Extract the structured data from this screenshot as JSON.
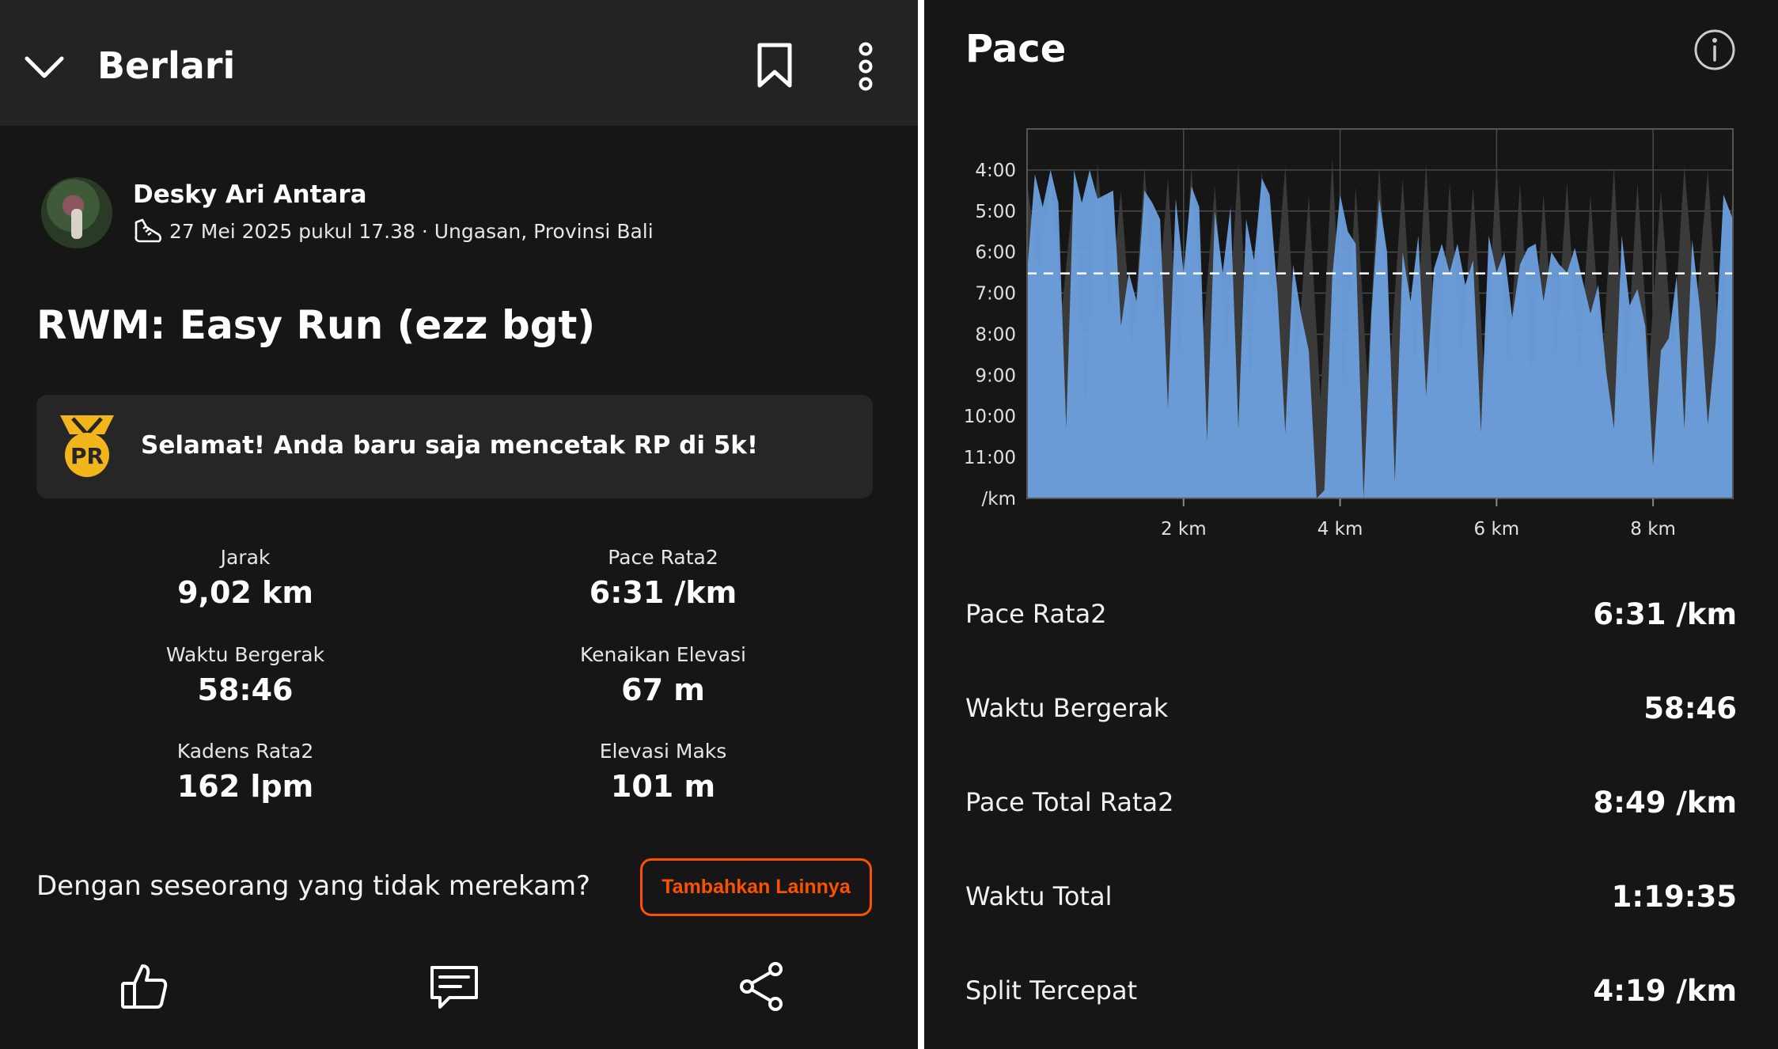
{
  "header": {
    "title": "Berlari"
  },
  "athlete": {
    "name": "Desky Ari Antara",
    "meta": "27 Mei 2025 pukul 17.38 · Ungasan, Provinsi Bali"
  },
  "activity": {
    "title": "RWM: Easy Run (ezz bgt)"
  },
  "pr_card": {
    "badge_text": "PR",
    "message": "Selamat! Anda baru saja mencetak RP di 5k!"
  },
  "stats": [
    {
      "label": "Jarak",
      "value": "9,02 km"
    },
    {
      "label": "Pace Rata2",
      "value": "6:31 /km"
    },
    {
      "label": "Waktu Bergerak",
      "value": "58:46"
    },
    {
      "label": "Kenaikan Elevasi",
      "value": "67 m"
    },
    {
      "label": "Kadens Rata2",
      "value": "162 lpm"
    },
    {
      "label": "Elevasi Maks",
      "value": "101 m"
    }
  ],
  "invite": {
    "text": "Dengan seseorang yang tidak merekam?",
    "button": "Tambahkan Lainnya"
  },
  "colors": {
    "accent": "#fc5200",
    "pace_fill": "#6fa3e3",
    "pr_gold": "#f2b51c",
    "background": "#161616"
  },
  "pace_panel": {
    "title": "Pace",
    "rows": [
      {
        "label": "Pace Rata2",
        "value": "6:31 /km"
      },
      {
        "label": "Waktu Bergerak",
        "value": "58:46"
      },
      {
        "label": "Pace Total Rata2",
        "value": "8:49 /km"
      },
      {
        "label": "Waktu Total",
        "value": "1:19:35"
      },
      {
        "label": "Split Tercepat",
        "value": "4:19 /km"
      }
    ]
  },
  "chart_data": {
    "type": "area",
    "title": "Pace",
    "xlabel": "",
    "ylabel": "",
    "x_ticks": [
      "2 km",
      "4 km",
      "6 km",
      "8 km"
    ],
    "y_ticks": [
      "4:00",
      "5:00",
      "6:00",
      "7:00",
      "8:00",
      "9:00",
      "10:00",
      "11:00",
      "/km"
    ],
    "x_unit": "km",
    "y_unit": "min/km",
    "xlim": [
      0,
      9.02
    ],
    "ylim_pace_min": [
      3.0,
      12.0
    ],
    "y_inverted": true,
    "reference_line": {
      "value": 6.52,
      "label": "Pace Rata2 6:31 /km",
      "style": "dashed"
    },
    "grid": true,
    "series": [
      {
        "style": "blue-filled",
        "x": [
          0.0,
          0.1,
          0.2,
          0.3,
          0.4,
          0.5,
          0.6,
          0.7,
          0.8,
          0.9,
          1.0,
          1.1,
          1.2,
          1.3,
          1.4,
          1.5,
          1.6,
          1.7,
          1.8,
          1.9,
          2.0,
          2.1,
          2.2,
          2.3,
          2.4,
          2.5,
          2.6,
          2.7,
          2.8,
          2.9,
          3.0,
          3.1,
          3.2,
          3.3,
          3.4,
          3.5,
          3.6,
          3.7,
          3.8,
          3.9,
          4.0,
          4.1,
          4.2,
          4.3,
          4.4,
          4.5,
          4.6,
          4.7,
          4.8,
          4.9,
          5.0,
          5.1,
          5.2,
          5.3,
          5.4,
          5.5,
          5.6,
          5.7,
          5.8,
          5.9,
          6.0,
          6.1,
          6.2,
          6.3,
          6.4,
          6.5,
          6.6,
          6.7,
          6.8,
          6.9,
          7.0,
          7.1,
          7.2,
          7.3,
          7.4,
          7.5,
          7.6,
          7.7,
          7.8,
          7.9,
          8.0,
          8.1,
          8.2,
          8.3,
          8.4,
          8.5,
          8.6,
          8.7,
          8.8,
          8.9,
          9.02
        ],
        "y": [
          6.5,
          4.1,
          4.9,
          4.0,
          4.8,
          10.3,
          4.0,
          4.8,
          4.0,
          4.7,
          4.6,
          4.5,
          7.8,
          6.5,
          7.2,
          4.5,
          4.8,
          5.2,
          9.8,
          4.7,
          6.5,
          4.4,
          4.9,
          10.6,
          5.0,
          6.5,
          4.9,
          10.3,
          5.2,
          6.2,
          4.2,
          4.6,
          7.0,
          10.4,
          6.3,
          7.5,
          8.4,
          12.0,
          11.8,
          6.6,
          4.6,
          5.5,
          5.8,
          12.0,
          7.5,
          4.7,
          6.0,
          11.6,
          6.0,
          7.2,
          5.6,
          9.5,
          6.4,
          5.8,
          6.5,
          5.8,
          6.8,
          6.2,
          10.4,
          5.6,
          6.5,
          6.0,
          7.6,
          6.3,
          5.9,
          5.8,
          7.2,
          6.0,
          6.3,
          6.5,
          5.9,
          6.7,
          7.5,
          6.8,
          8.9,
          10.3,
          5.6,
          7.3,
          6.9,
          7.8,
          11.2,
          8.4,
          8.1,
          6.6,
          10.3,
          5.7,
          7.4,
          10.2,
          8.2,
          4.6,
          5.2
        ]
      },
      {
        "style": "dark-gray-filled",
        "x": [
          0.0,
          0.15,
          0.3,
          0.45,
          0.6,
          0.75,
          0.9,
          1.05,
          1.2,
          1.35,
          1.5,
          1.65,
          1.8,
          1.95,
          2.1,
          2.25,
          2.4,
          2.55,
          2.7,
          2.85,
          3.0,
          3.15,
          3.3,
          3.45,
          3.6,
          3.75,
          3.9,
          4.05,
          4.2,
          4.35,
          4.5,
          4.65,
          4.8,
          4.95,
          5.1,
          5.25,
          5.4,
          5.55,
          5.7,
          5.85,
          6.0,
          6.15,
          6.3,
          6.45,
          6.6,
          6.75,
          6.9,
          7.05,
          7.2,
          7.35,
          7.5,
          7.65,
          7.8,
          7.95,
          8.1,
          8.25,
          8.4,
          8.55,
          8.7,
          8.85,
          9.02
        ],
        "y": [
          4.3,
          6.5,
          4.2,
          7.3,
          4.4,
          9.8,
          3.8,
          7.5,
          4.5,
          8.4,
          3.9,
          7.8,
          4.2,
          8.8,
          3.9,
          8.0,
          4.4,
          8.5,
          3.8,
          9.2,
          4.0,
          7.6,
          3.9,
          8.8,
          4.6,
          9.6,
          3.7,
          9.5,
          4.4,
          9.1,
          3.9,
          8.4,
          4.2,
          8.8,
          3.8,
          9.4,
          4.3,
          8.6,
          4.4,
          9.3,
          3.8,
          8.9,
          4.3,
          9.2,
          4.6,
          8.7,
          4.3,
          9.0,
          4.6,
          8.8,
          3.9,
          9.3,
          4.3,
          8.7,
          4.5,
          8.4,
          3.9,
          7.4,
          4.0,
          8.5,
          4.6
        ]
      }
    ]
  }
}
